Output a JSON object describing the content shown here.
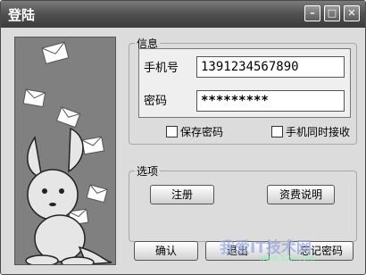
{
  "window": {
    "title": "登陆"
  },
  "info_group": {
    "title": "信息"
  },
  "fields": {
    "phone_label": "手机号",
    "phone_value": "1391234567890",
    "password_label": "密码",
    "password_value": "*********"
  },
  "options": {
    "save_password": "保存密码",
    "phone_receive": "手机同时接收"
  },
  "options_group": {
    "title": "选项"
  },
  "buttons": {
    "register": "注册",
    "fee_info": "资费说明",
    "confirm": "确认",
    "exit": "退出",
    "forgot": "忘记密码"
  },
  "watermark": {
    "line1": "我爱IT技术网",
    "line2": "www.52ij.com"
  }
}
